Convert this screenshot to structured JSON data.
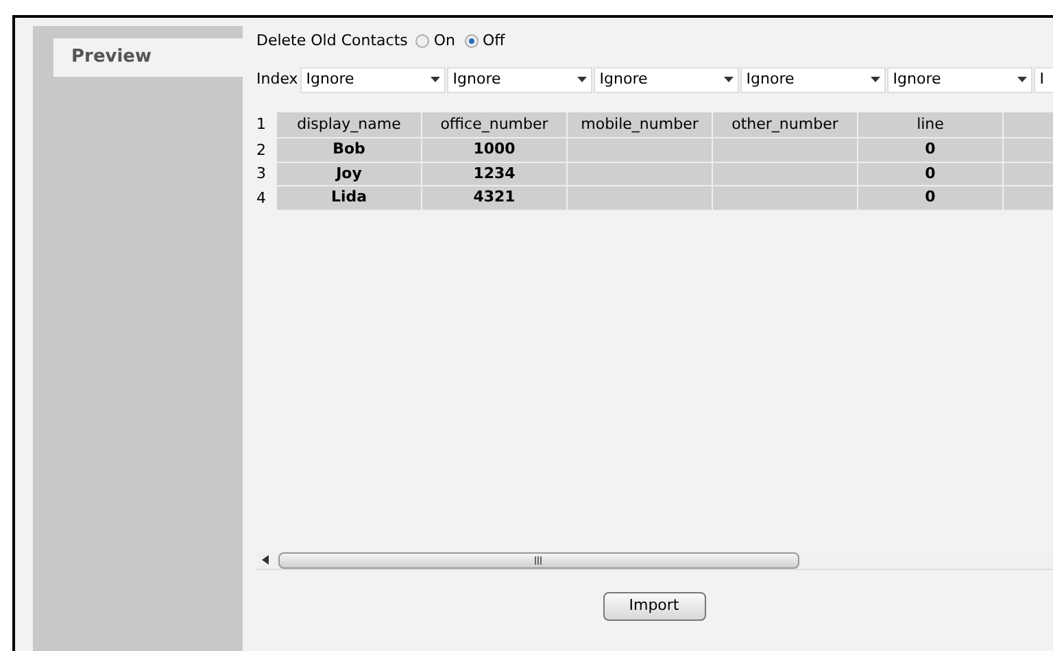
{
  "sidebar": {
    "tabs": [
      {
        "label": "Preview",
        "selected": true
      }
    ]
  },
  "delete_old_contacts": {
    "label": "Delete Old Contacts",
    "options": [
      {
        "label": "On",
        "selected": false
      },
      {
        "label": "Off",
        "selected": true
      }
    ]
  },
  "index_label": "Index",
  "column_mappings": [
    {
      "value": "Ignore"
    },
    {
      "value": "Ignore"
    },
    {
      "value": "Ignore"
    },
    {
      "value": "Ignore"
    },
    {
      "value": "Ignore"
    },
    {
      "value": "I"
    }
  ],
  "table": {
    "header_index": "1",
    "columns": [
      "display_name",
      "office_number",
      "mobile_number",
      "other_number",
      "line"
    ],
    "rows": [
      {
        "index": "2",
        "cells": [
          "Bob",
          "1000",
          "",
          "",
          "0"
        ]
      },
      {
        "index": "3",
        "cells": [
          "Joy",
          "1234",
          "",
          "",
          "0"
        ]
      },
      {
        "index": "4",
        "cells": [
          "Lida",
          "4321",
          "",
          "",
          "0"
        ]
      }
    ]
  },
  "import_button": "Import"
}
